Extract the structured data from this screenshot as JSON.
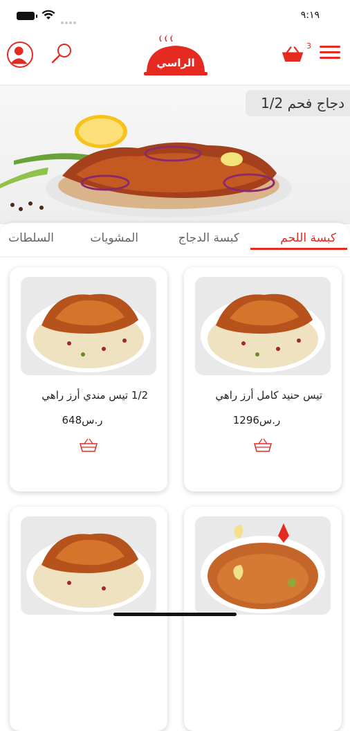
{
  "status_bar": {
    "time": "٩:١٩"
  },
  "header": {
    "logo_text": "الراسي",
    "cart_count": "3",
    "accent_color": "#e52a22"
  },
  "hero": {
    "title": "1/2 دجاج فحم"
  },
  "tabs": [
    {
      "label": "كبسة اللحم",
      "active": true
    },
    {
      "label": "كبسة الدجاج",
      "active": false
    },
    {
      "label": "المشويات",
      "active": false
    },
    {
      "label": "السلطات",
      "active": false
    }
  ],
  "products": [
    {
      "name": "تيس حنيد كامل أرز راهي",
      "price": "1296",
      "currency": "ر.س"
    },
    {
      "name": "1/2 تيس مندي أرز راهي",
      "price": "648",
      "currency": "ر.س"
    },
    {
      "name": "",
      "price": "",
      "currency": ""
    },
    {
      "name": "",
      "price": "",
      "currency": ""
    }
  ],
  "icons": [
    "profile-icon",
    "search-icon",
    "logo-icon",
    "cart-icon",
    "menu-icon",
    "basket-icon"
  ]
}
